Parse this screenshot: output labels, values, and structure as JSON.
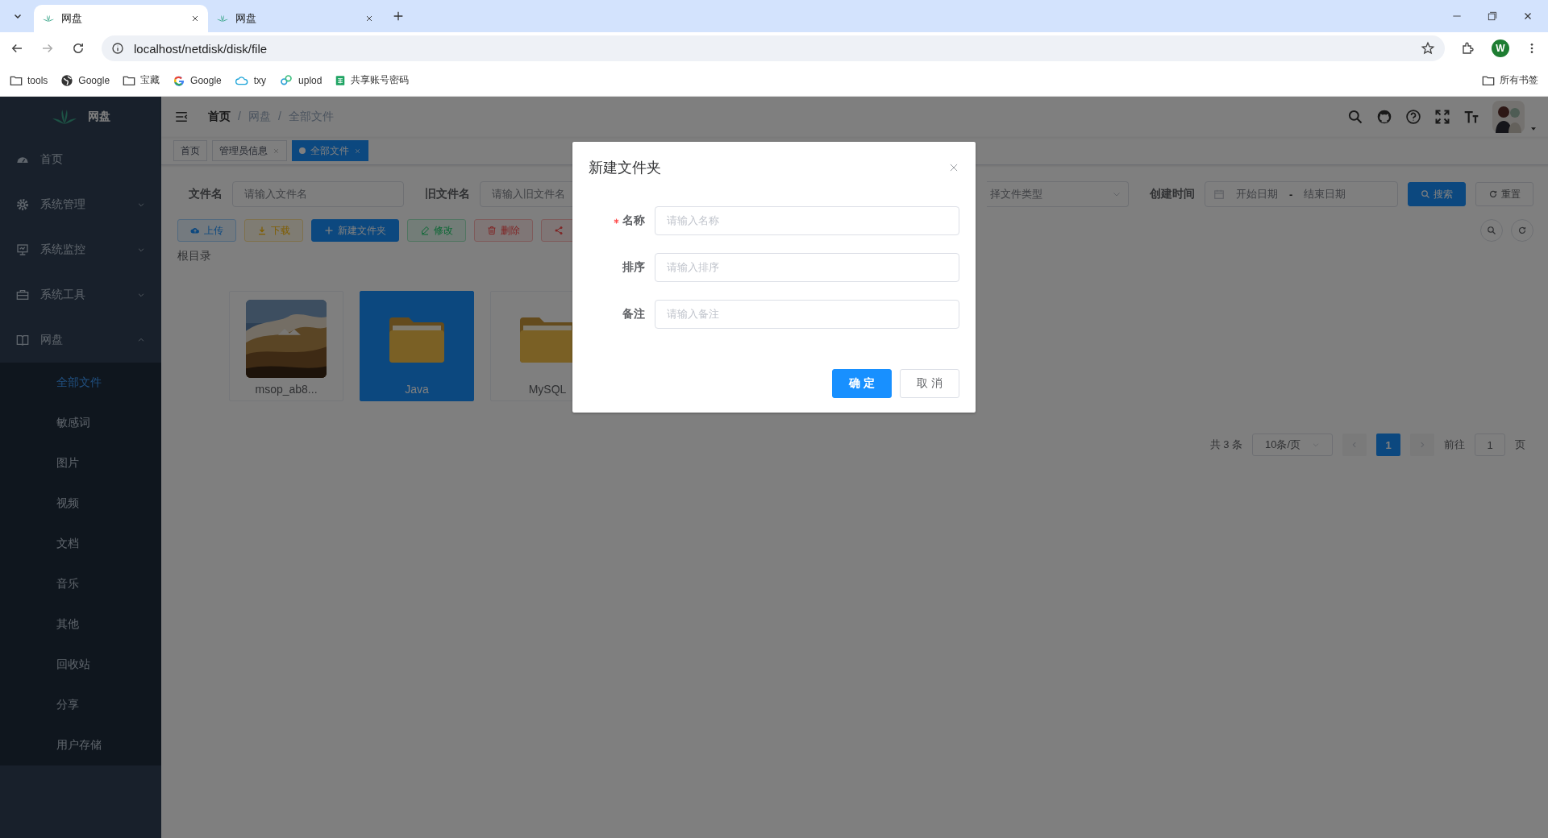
{
  "browser": {
    "tabs": [
      {
        "title": "网盘",
        "selected": true
      },
      {
        "title": "网盘",
        "selected": false
      }
    ],
    "url": "localhost/netdisk/disk/file",
    "profile": "W",
    "bookmarks": [
      {
        "label": "tools",
        "kind": "folder"
      },
      {
        "label": "Google",
        "kind": "globe"
      },
      {
        "label": "宝藏",
        "kind": "folder"
      },
      {
        "label": "Google",
        "kind": "google"
      },
      {
        "label": "txy",
        "kind": "cloud"
      },
      {
        "label": "uplod",
        "kind": "app"
      },
      {
        "label": "共享账号密码",
        "kind": "sheet"
      }
    ],
    "all_bookmarks": "所有书签"
  },
  "sidebar": {
    "title": "网盘",
    "items": [
      {
        "label": "首页",
        "kind": "dashboard"
      },
      {
        "label": "系统管理",
        "kind": "gear",
        "expanded": false
      },
      {
        "label": "系统监控",
        "kind": "monitor",
        "expanded": false
      },
      {
        "label": "系统工具",
        "kind": "toolbox",
        "expanded": false
      },
      {
        "label": "网盘",
        "kind": "book",
        "expanded": true,
        "children": [
          {
            "label": "全部文件",
            "selected": true
          },
          {
            "label": "敏感词",
            "selected": false
          },
          {
            "label": "图片",
            "selected": false
          },
          {
            "label": "视频",
            "selected": false
          },
          {
            "label": "文档",
            "selected": false
          },
          {
            "label": "音乐",
            "selected": false
          },
          {
            "label": "其他",
            "selected": false
          },
          {
            "label": "回收站",
            "selected": false
          },
          {
            "label": "分享",
            "selected": false
          },
          {
            "label": "用户存储",
            "selected": false
          }
        ]
      }
    ]
  },
  "breadcrumb": {
    "separator": "/",
    "items": [
      "首页",
      "网盘",
      "全部文件"
    ]
  },
  "tags": [
    {
      "label": "首页",
      "selected": false,
      "closable": false
    },
    {
      "label": "管理员信息",
      "selected": false,
      "closable": true
    },
    {
      "label": "全部文件",
      "selected": true,
      "closable": true
    }
  ],
  "filters": {
    "fields": [
      {
        "label": "文件名",
        "placeholder": "请输入文件名"
      },
      {
        "label": "旧文件名",
        "placeholder": "请输入旧文件名"
      }
    ],
    "type_select": {
      "placeholder": "择文件类型"
    },
    "date": {
      "label": "创建时间",
      "start_placeholder": "开始日期",
      "separator": "-",
      "end_placeholder": "结束日期"
    },
    "buttons": [
      {
        "label": "搜索",
        "kind": "primary"
      },
      {
        "label": "重置",
        "kind": "default"
      }
    ]
  },
  "actions": [
    {
      "label": "上传",
      "kind": "upload"
    },
    {
      "label": "下载",
      "kind": "download"
    },
    {
      "label": "新建文件夹",
      "kind": "create"
    },
    {
      "label": "修改",
      "kind": "edit"
    },
    {
      "label": "删除",
      "kind": "delete"
    },
    {
      "kind": "share"
    }
  ],
  "path": "根目录",
  "files": [
    {
      "name": "msop_ab8...",
      "selected": false
    },
    {
      "name": "Java",
      "kind": "folder",
      "selected": true
    },
    {
      "name": "MySQL",
      "kind": "folder",
      "selected": false
    }
  ],
  "pagination": {
    "total": "共 3 条",
    "page_size": "10条/页",
    "pages": [
      {
        "label": "1",
        "selected": true
      }
    ],
    "goto_label": "前往",
    "goto_value": "1",
    "goto_unit": "页"
  },
  "dialog": {
    "title": "新建文件夹",
    "fields": [
      {
        "label": "名称",
        "required": true,
        "placeholder": "请输入名称"
      },
      {
        "label": "排序",
        "required": false,
        "placeholder": "请输入排序"
      },
      {
        "label": "备注",
        "required": false,
        "placeholder": "请输入备注"
      }
    ],
    "buttons": [
      {
        "label": "确 定",
        "kind": "primary"
      },
      {
        "label": "取 消",
        "kind": "default"
      }
    ]
  }
}
